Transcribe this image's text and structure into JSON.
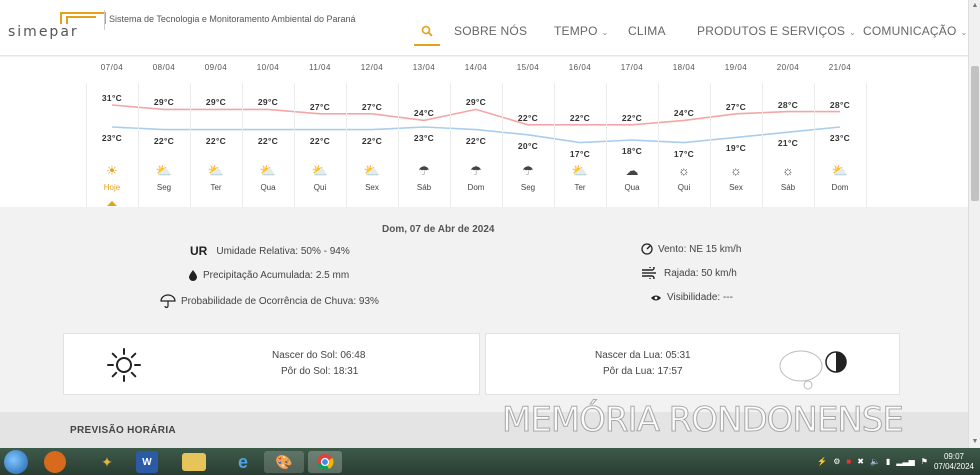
{
  "header": {
    "logo_text": "simepar",
    "tagline": "Sistema de Tecnologia e Monitoramento Ambiental do Paraná",
    "nav": [
      {
        "label": "SOBRE NÓS",
        "dropdown": false
      },
      {
        "label": "TEMPO",
        "dropdown": true
      },
      {
        "label": "CLIMA",
        "dropdown": false
      },
      {
        "label": "PRODUTOS E SERVIÇOS",
        "dropdown": true
      },
      {
        "label": "COMUNICAÇÃO",
        "dropdown": true
      }
    ],
    "chevron": "⌄"
  },
  "forecast": {
    "days": [
      {
        "date": "07/04",
        "max": "31°C",
        "min": "23°C",
        "label": "Hoje",
        "icon": "☀",
        "icon_name": "sun-cloud-icon"
      },
      {
        "date": "08/04",
        "max": "29°C",
        "min": "22°C",
        "label": "Seg",
        "icon": "⛅",
        "icon_name": "cloud-rain-sun-icon"
      },
      {
        "date": "09/04",
        "max": "29°C",
        "min": "22°C",
        "label": "Ter",
        "icon": "⛅",
        "icon_name": "cloud-rain-sun-icon"
      },
      {
        "date": "10/04",
        "max": "29°C",
        "min": "22°C",
        "label": "Qua",
        "icon": "⛅",
        "icon_name": "cloud-rain-sun-icon"
      },
      {
        "date": "11/04",
        "max": "27°C",
        "min": "22°C",
        "label": "Qui",
        "icon": "⛅",
        "icon_name": "cloud-rain-sun-icon"
      },
      {
        "date": "12/04",
        "max": "27°C",
        "min": "22°C",
        "label": "Sex",
        "icon": "⛅",
        "icon_name": "cloud-rain-sun-icon"
      },
      {
        "date": "13/04",
        "max": "24°C",
        "min": "23°C",
        "label": "Sáb",
        "icon": "☂",
        "icon_name": "cloud-rain-icon"
      },
      {
        "date": "14/04",
        "max": "29°C",
        "min": "22°C",
        "label": "Dom",
        "icon": "☂",
        "icon_name": "cloud-rain-icon"
      },
      {
        "date": "15/04",
        "max": "22°C",
        "min": "20°C",
        "label": "Seg",
        "icon": "☂",
        "icon_name": "cloud-rain-icon"
      },
      {
        "date": "16/04",
        "max": "22°C",
        "min": "17°C",
        "label": "Ter",
        "icon": "⛅",
        "icon_name": "cloud-sun-icon"
      },
      {
        "date": "17/04",
        "max": "22°C",
        "min": "18°C",
        "label": "Qua",
        "icon": "☁",
        "icon_name": "cloud-moon-icon"
      },
      {
        "date": "18/04",
        "max": "24°C",
        "min": "17°C",
        "label": "Qui",
        "icon": "☼",
        "icon_name": "sun-icon"
      },
      {
        "date": "19/04",
        "max": "27°C",
        "min": "19°C",
        "label": "Sex",
        "icon": "☼",
        "icon_name": "sun-icon"
      },
      {
        "date": "20/04",
        "max": "28°C",
        "min": "21°C",
        "label": "Sáb",
        "icon": "☼",
        "icon_name": "sun-icon"
      },
      {
        "date": "21/04",
        "max": "28°C",
        "min": "23°C",
        "label": "Dom",
        "icon": "⛅",
        "icon_name": "cloud-rain-sun-icon"
      }
    ],
    "max_values": [
      31,
      29,
      29,
      29,
      27,
      27,
      24,
      29,
      22,
      22,
      22,
      24,
      27,
      28,
      28
    ],
    "min_values": [
      23,
      22,
      22,
      22,
      22,
      22,
      23,
      22,
      20,
      17,
      18,
      17,
      19,
      21,
      23
    ],
    "max_color": "#f4a6a6",
    "min_color": "#a9cdee"
  },
  "details": {
    "date_title": "Dom, 07 de Abr de 2024",
    "ur_abbr": "UR",
    "humidity": "Umidade Relativa: 50% - 94%",
    "precip": "Precipitação Acumulada: 2.5 mm",
    "rain_prob": "Probabilidade de Ocorrência de Chuva: 93%",
    "wind": "Vento: NE 15 km/h",
    "gust": "Rajada: 50 km/h",
    "visibility": "Visibilidade: ---"
  },
  "sun": {
    "sunrise": "Nascer do Sol: 06:48",
    "sunset": "Pôr do Sol: 18:31"
  },
  "moon": {
    "moonrise": "Nascer da Lua: 05:31",
    "moonset": "Pôr da Lua: 17:57"
  },
  "hourly": {
    "title": "PREVISÃO HORÁRIA"
  },
  "watermark": "MEMÓRIA RONDONENSE",
  "taskbar": {
    "time": "09:07",
    "date": "07/04/2024"
  }
}
